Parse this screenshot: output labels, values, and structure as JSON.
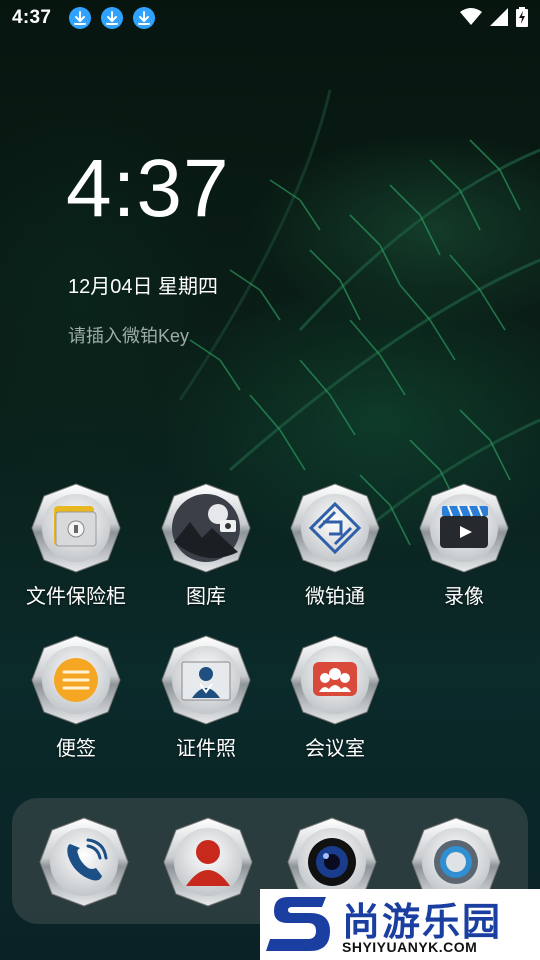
{
  "status_bar": {
    "time": "4:37",
    "notification_icons": [
      "download-icon",
      "download-icon",
      "download-icon"
    ],
    "system_icons": [
      "wifi-icon",
      "cell-signal-icon",
      "battery-charging-icon"
    ]
  },
  "clock_widget": {
    "time": "4:37",
    "date": "12月04日 星期四",
    "hint": "请插入微铂Key"
  },
  "apps": [
    {
      "label": "文件保险柜",
      "icon": "file-safe-icon"
    },
    {
      "label": "图库",
      "icon": "gallery-icon"
    },
    {
      "label": "微铂通",
      "icon": "weibotong-icon"
    },
    {
      "label": "录像",
      "icon": "video-recorder-icon"
    },
    {
      "label": "便签",
      "icon": "notes-icon"
    },
    {
      "label": "证件照",
      "icon": "id-photo-icon"
    },
    {
      "label": "会议室",
      "icon": "meeting-room-icon"
    }
  ],
  "dock": [
    {
      "icon": "phone-icon"
    },
    {
      "icon": "contacts-icon"
    },
    {
      "icon": "camera-icon"
    },
    {
      "icon": "settings-icon"
    }
  ],
  "watermark": {
    "brand": "尚游乐园",
    "url": "SHYIYUANYK.COM",
    "logo_letter": "S"
  },
  "colors": {
    "download_badge": "#2fa3ff",
    "watermark_blue": "#1a3fa0",
    "dock_bg": "rgba(70,80,80,0.55)"
  }
}
